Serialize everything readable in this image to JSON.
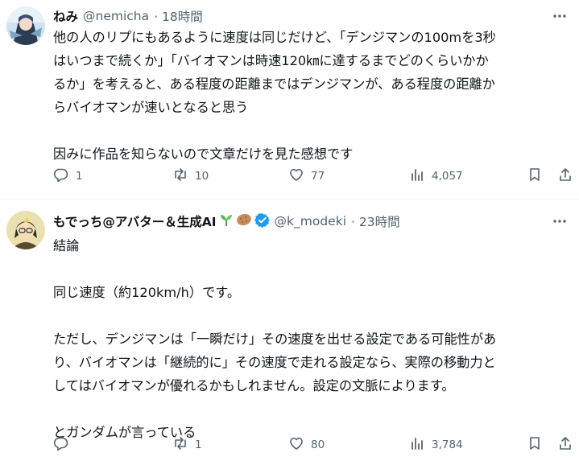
{
  "posts": [
    {
      "name": "ねみ",
      "handle": "@nemicha",
      "time": "· 18時間",
      "text": "他の人のリプにもあるように速度は同じだけど、「デンジマンの100mを3秒\nはいつまで続くか」「バイオマンは時速120㎞に達するまでどのくらいかか\nるか」を考えると、ある程度の距離まではデンジマンが、ある程度の距離か\nらバイオマンが速いとなると思う\n\n因みに作品を知らないので文章だけを見た感想です",
      "replies": "1",
      "reposts": "10",
      "likes": "77",
      "views": "4,057"
    },
    {
      "name": "もでっち@アバター＆生成AI",
      "handle": "@k_modeki",
      "time": "· 23時間",
      "text": "結論\n\n同じ速度（約120km/h）です。\n\nただし、デンジマンは「一瞬だけ」その速度を出せる設定である可能性があ\nり、バイオマンは「継続的に」その速度で走れる設定なら、実際の移動力と\nしてはバイオマンが優れるかもしれません。設定の文脈によります。\n\nとガンダムが言っている",
      "replies": "",
      "reposts": "1",
      "likes": "80",
      "views": "3,784"
    }
  ],
  "icons": [
    "avatar",
    "more-icon",
    "reply-icon",
    "repost-icon",
    "like-icon",
    "views-icon",
    "bookmark-icon",
    "share-icon",
    "seedling-emoji",
    "potato-emoji",
    "verified-badge-icon"
  ],
  "colors": {
    "text": "#0f1419",
    "secondary": "#536471",
    "verified": "#1d9bf0",
    "divider": "#eff3f4"
  }
}
